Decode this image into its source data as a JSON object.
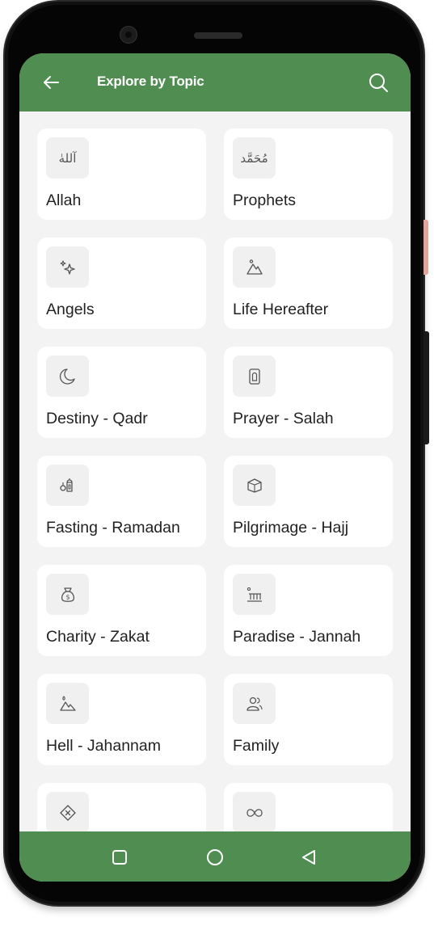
{
  "header": {
    "title": "Explore by Topic"
  },
  "icons": {
    "back": "arrow-left-icon",
    "search": "search-icon"
  },
  "topics": [
    {
      "label": "Allah",
      "icon": "allah-calligraphy-icon",
      "glyph": "آللهٰ"
    },
    {
      "label": "Prophets",
      "icon": "muhammad-calligraphy-icon",
      "glyph": "مُحَمَّد"
    },
    {
      "label": "Angels",
      "icon": "sparkles-icon"
    },
    {
      "label": "Life Hereafter",
      "icon": "mountain-sun-icon"
    },
    {
      "label": "Destiny - Qadr",
      "icon": "crescent-moon-icon"
    },
    {
      "label": "Prayer - Salah",
      "icon": "prayer-mat-icon"
    },
    {
      "label": "Fasting - Ramadan",
      "icon": "lantern-icon"
    },
    {
      "label": "Pilgrimage - Hajj",
      "icon": "kaaba-icon"
    },
    {
      "label": "Charity - Zakat",
      "icon": "money-bag-icon"
    },
    {
      "label": "Paradise - Jannah",
      "icon": "garden-icon"
    },
    {
      "label": "Hell - Jahannam",
      "icon": "fire-mountain-icon"
    },
    {
      "label": "Family",
      "icon": "people-icon"
    },
    {
      "label": "",
      "icon": "forbidden-icon"
    },
    {
      "label": "",
      "icon": "infinity-icon"
    }
  ],
  "colors": {
    "primary": "#4f8e50",
    "background": "#f3f3f3",
    "card": "#ffffff"
  },
  "navigation": {
    "buttons": [
      "recents-square-icon",
      "home-circle-icon",
      "back-triangle-icon"
    ]
  }
}
